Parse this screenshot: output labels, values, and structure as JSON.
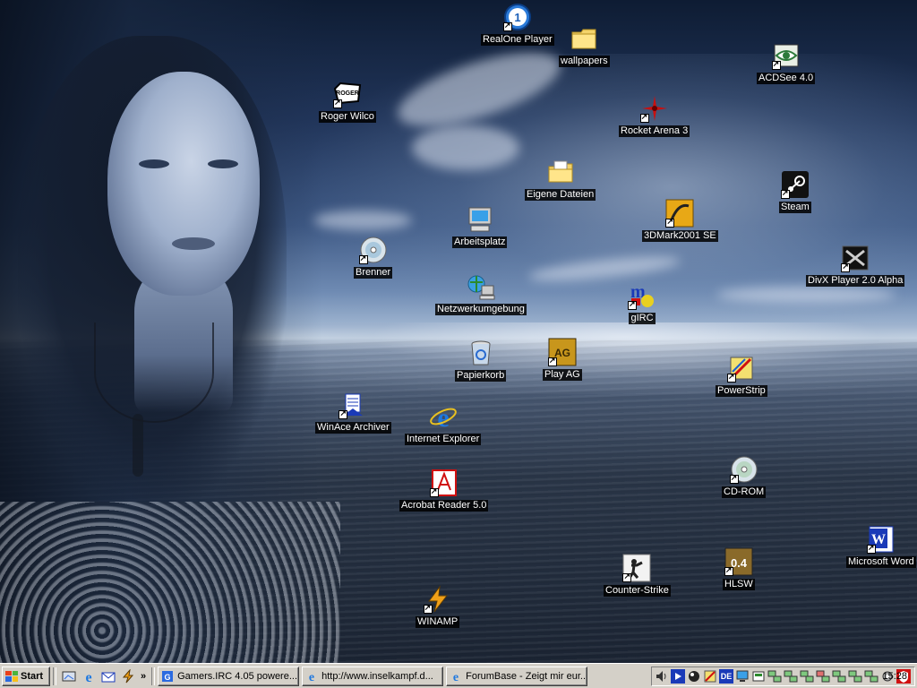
{
  "desktop": {
    "icons": [
      {
        "id": "realone",
        "label": "RealOne Player"
      },
      {
        "id": "wallpapers",
        "label": "wallpapers"
      },
      {
        "id": "acdsee",
        "label": "ACDSee 4.0"
      },
      {
        "id": "roger-wilco",
        "label": "Roger Wilco"
      },
      {
        "id": "rocket-arena",
        "label": "Rocket Arena 3"
      },
      {
        "id": "eigene-dateien",
        "label": "Eigene Dateien"
      },
      {
        "id": "steam",
        "label": "Steam"
      },
      {
        "id": "arbeitsplatz",
        "label": "Arbeitsplatz"
      },
      {
        "id": "3dmark",
        "label": "3DMark2001 SE"
      },
      {
        "id": "brenner",
        "label": "Brenner"
      },
      {
        "id": "divx",
        "label": "DivX Player 2.0 Alpha"
      },
      {
        "id": "netzwerk",
        "label": "Netzwerkumgebung"
      },
      {
        "id": "girc",
        "label": "gIRC"
      },
      {
        "id": "papierkorb",
        "label": "Papierkorb"
      },
      {
        "id": "play-ag",
        "label": "Play AG"
      },
      {
        "id": "powerstrip",
        "label": "PowerStrip"
      },
      {
        "id": "winace",
        "label": "WinAce Archiver"
      },
      {
        "id": "ie",
        "label": "Internet Explorer"
      },
      {
        "id": "cdrom",
        "label": "CD-ROM"
      },
      {
        "id": "acrobat",
        "label": "Acrobat Reader 5.0"
      },
      {
        "id": "word",
        "label": "Microsoft Word"
      },
      {
        "id": "counter-strike",
        "label": "Counter-Strike"
      },
      {
        "id": "hlsw",
        "label": "HLSW"
      },
      {
        "id": "winamp",
        "label": "WINAMP"
      }
    ]
  },
  "taskbar": {
    "start_label": "Start",
    "quick_launch": [
      "show-desktop-icon",
      "internet-explorer-icon",
      "outlook-express-icon",
      "winamp-icon"
    ],
    "overflow": "»",
    "tasks": [
      {
        "label": "Gamers.IRC 4.05 powere...",
        "icon": "irc-icon"
      },
      {
        "label": "http://www.inselkampf.d...",
        "icon": "internet-explorer-icon"
      },
      {
        "label": "ForumBase - Zeigt mir eur...",
        "icon": "internet-explorer-icon"
      }
    ],
    "tray": {
      "icons": [
        "volume-icon",
        "media-player-icon",
        "network-ball-icon",
        "pen-tool-icon",
        "language-de-icon",
        "monitor-icon",
        "display-icon",
        "network-1-icon",
        "network-2-icon",
        "network-3-icon",
        "network-4-icon",
        "network-5-icon",
        "network-6-icon",
        "network-7-icon",
        "settings-icon",
        "antivirus-icon"
      ],
      "language": "DE",
      "clock": "15:28"
    }
  }
}
